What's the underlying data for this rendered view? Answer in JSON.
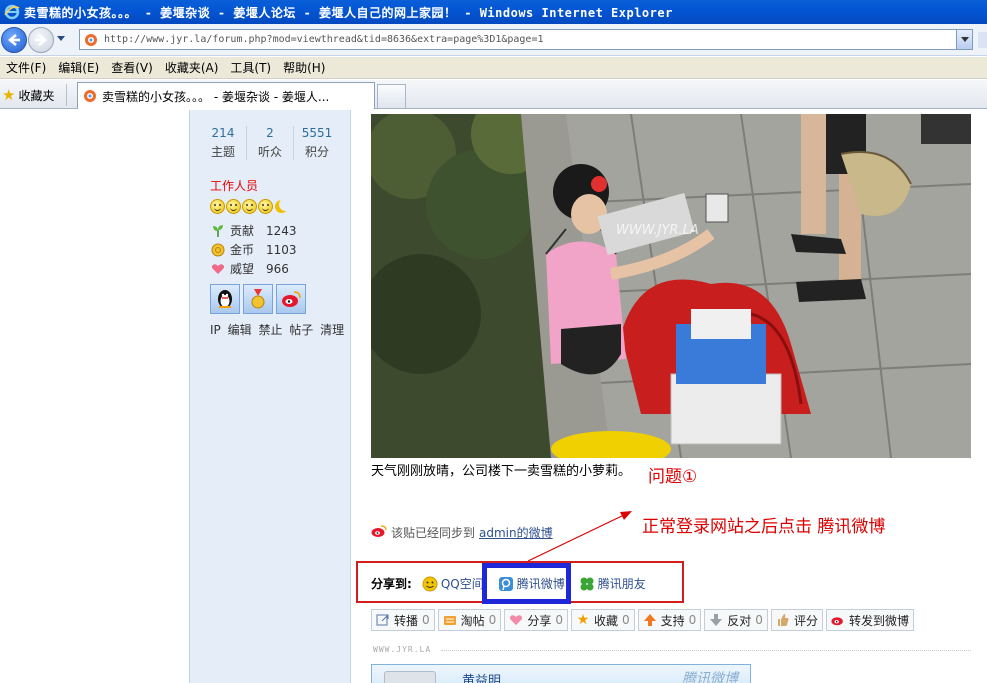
{
  "window": {
    "title": "卖雪糕的小女孩。。。 - 姜堰杂谈 - 姜堰人论坛 - 姜堰人自己的网上家园！ - Windows Internet Explorer"
  },
  "address": {
    "url": "http://www.jyr.la/forum.php?mod=viewthread&tid=8636&extra=page%3D1&page=1"
  },
  "menu": {
    "items": [
      "文件(F)",
      "编辑(E)",
      "查看(V)",
      "收藏夹(A)",
      "工具(T)",
      "帮助(H)"
    ]
  },
  "tabs": {
    "favorites_label": "收藏夹",
    "active_tab_label": "卖雪糕的小女孩。。。 - 姜堰杂谈 - 姜堰人..."
  },
  "profile": {
    "stats": [
      {
        "value": "214",
        "label": "主题"
      },
      {
        "value": "2",
        "label": "听众"
      },
      {
        "value": "5551",
        "label": "积分"
      }
    ],
    "role": "工作人员",
    "credits": [
      {
        "label": "贡献",
        "value": "1243"
      },
      {
        "label": "金币",
        "value": "1103"
      },
      {
        "label": "威望",
        "value": "966"
      }
    ],
    "admin_links": [
      "IP",
      "编辑",
      "禁止",
      "帖子",
      "清理"
    ]
  },
  "post": {
    "image_watermark": "WWW.JYR.LA",
    "caption": "天气刚刚放晴，公司楼下一卖雪糕的小萝莉。",
    "synced_text": "该贴已经同步到",
    "synced_link": "admin的微博"
  },
  "annotations": {
    "question": "问题①",
    "tip": "正常登录网站之后点击 腾讯微博"
  },
  "share": {
    "label": "分享到:",
    "items": [
      "QQ空间",
      "腾讯微博",
      "腾讯朋友"
    ]
  },
  "actions": [
    {
      "label": "转播",
      "count": "0"
    },
    {
      "label": "淘帖",
      "count": "0"
    },
    {
      "label": "分享",
      "count": "0"
    },
    {
      "label": "收藏",
      "count": "0"
    },
    {
      "label": "支持",
      "count": "0"
    },
    {
      "label": "反对",
      "count": "0"
    },
    {
      "label": "评分",
      "count": ""
    },
    {
      "label": "转发到微博",
      "count": ""
    }
  ],
  "footer": {
    "watermark": "WWW.JYR.LA",
    "card_name": "黄益明",
    "card_brand": "腾讯微博"
  },
  "colors": {
    "annotation_red": "#dd0000",
    "highlight_blue": "#1e28d8",
    "link_blue": "#2f4f8f"
  }
}
